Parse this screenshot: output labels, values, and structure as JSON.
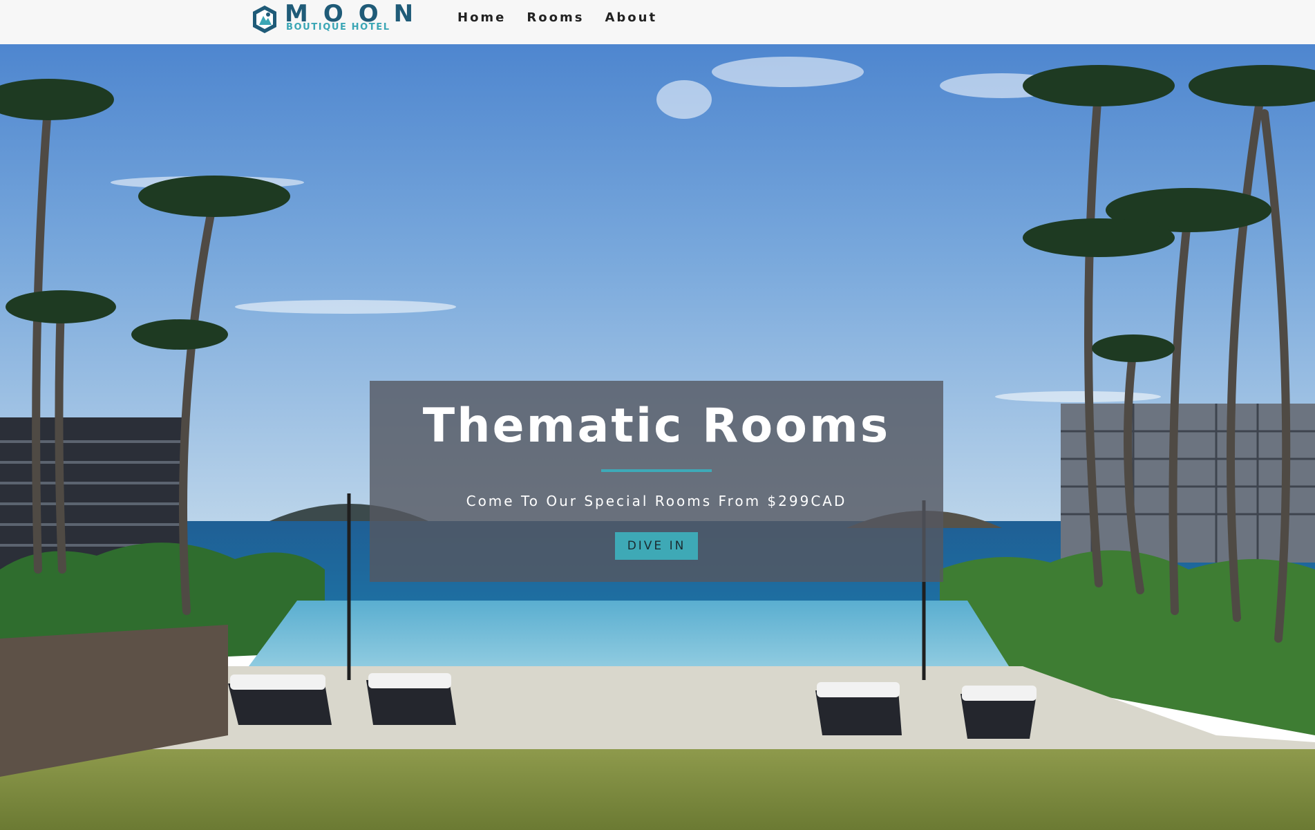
{
  "brand": {
    "name": "MOON",
    "tagline": "BOUTIQUE HOTEL",
    "icon": "moon-hexagon-logo-icon",
    "colors": {
      "primary": "#1f5b78",
      "accent": "#3aa6b5"
    }
  },
  "nav": {
    "items": [
      {
        "label": "Home"
      },
      {
        "label": "Rooms"
      },
      {
        "label": "About"
      }
    ]
  },
  "hero": {
    "background": "tropical infinity pool with palm trees and ocean",
    "title": "Thematic Rooms",
    "subtitle": "Come To Our Special Rooms From $299CAD",
    "button_label": "DIVE IN",
    "accent_color": "#3ea9b6"
  }
}
